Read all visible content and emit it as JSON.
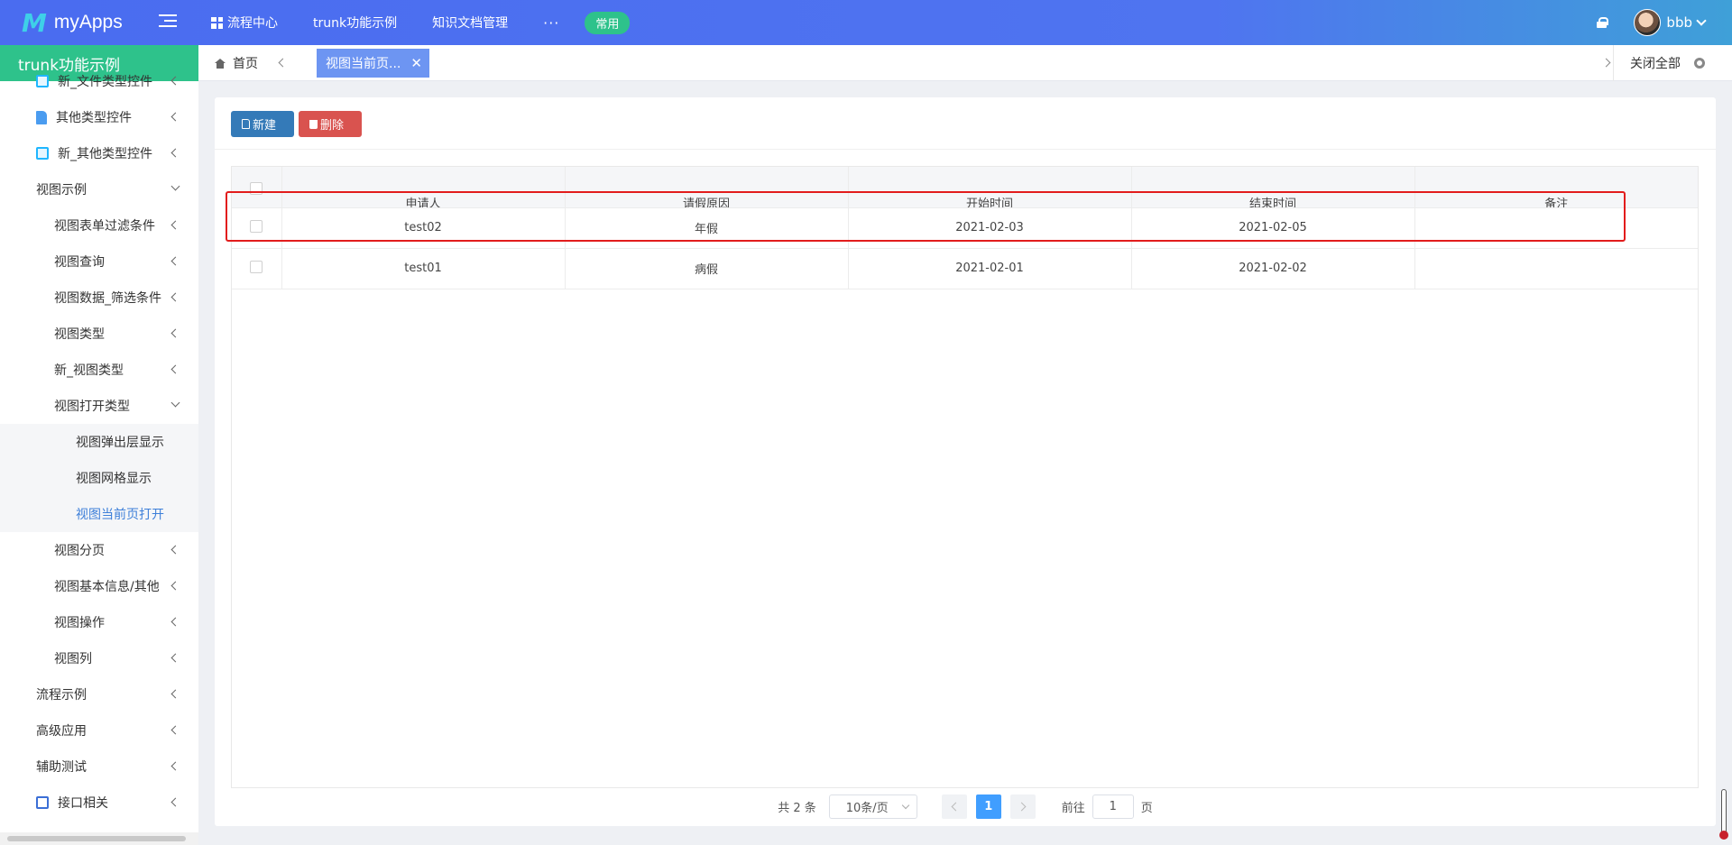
{
  "app": {
    "logo_mark": "M",
    "name": "myApps"
  },
  "topnav": {
    "items": [
      {
        "label": "流程中心"
      },
      {
        "label": "trunk功能示例"
      },
      {
        "label": "知识文档管理"
      }
    ],
    "more": "···",
    "favorite_pill": "常用"
  },
  "user": {
    "name": "bbb"
  },
  "sidebar": {
    "title": "trunk功能示例",
    "items": [
      {
        "label": "新_文件类型控件"
      },
      {
        "label": "其他类型控件"
      },
      {
        "label": "新_其他类型控件"
      },
      {
        "label": "视图示例"
      },
      {
        "label": "视图表单过滤条件"
      },
      {
        "label": "视图查询"
      },
      {
        "label": "视图数据_筛选条件"
      },
      {
        "label": "视图类型"
      },
      {
        "label": "新_视图类型"
      },
      {
        "label": "视图打开类型"
      },
      {
        "label": "视图弹出层显示"
      },
      {
        "label": "视图网格显示"
      },
      {
        "label": "视图当前页打开"
      },
      {
        "label": "视图分页"
      },
      {
        "label": "视图基本信息/其他"
      },
      {
        "label": "视图操作"
      },
      {
        "label": "视图列"
      },
      {
        "label": "流程示例"
      },
      {
        "label": "高级应用"
      },
      {
        "label": "辅助测试"
      },
      {
        "label": "接口相关"
      }
    ]
  },
  "tabs": {
    "home": "首页",
    "active": "视图当前页...",
    "close_icon": "✕",
    "close_all": "关闭全部"
  },
  "toolbar": {
    "new_label": "新建",
    "delete_label": "删除"
  },
  "table": {
    "columns": [
      "申请人",
      "请假原因",
      "开始时间",
      "结束时间",
      "备注"
    ],
    "rows": [
      {
        "applicant": "test02",
        "reason": "年假",
        "start": "2021-02-03",
        "end": "2021-02-05",
        "note": ""
      },
      {
        "applicant": "test01",
        "reason": "病假",
        "start": "2021-02-01",
        "end": "2021-02-02",
        "note": ""
      }
    ]
  },
  "pagination": {
    "total": "共 2 条",
    "page_size": "10条/页",
    "current_page": "1",
    "goto_prefix": "前往",
    "goto_value": "1",
    "goto_suffix": "页"
  },
  "colors": {
    "topbar": "#4a6cf0",
    "sidebar_title": "#2ec28b",
    "active_tab": "#6d95f2",
    "new_button": "#347ab8",
    "delete_button": "#d9534f",
    "current_page": "#409eff",
    "highlight": "#e21c1c"
  }
}
